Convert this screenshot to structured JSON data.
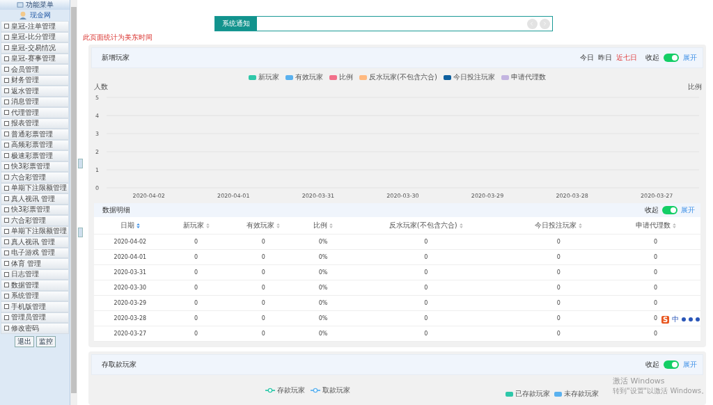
{
  "sidebar": {
    "title": "功能菜单",
    "user": "现金网",
    "items": [
      "皇冠-注单管理",
      "皇冠-比分管理",
      "皇冠-交易情况",
      "皇冠-赛事管理",
      "会员管理",
      "财务管理",
      "返水管理",
      "消息管理",
      "代理管理",
      "报表管理",
      "普通彩票管理",
      "高频彩票管理",
      "极速彩票管理",
      "快3彩票管理",
      "六合彩管理",
      "单期下注限额管理",
      "真人视讯 管理",
      "快3彩票管理",
      "六合彩管理",
      "单期下注限额管理",
      "真人视讯 管理",
      "电子游戏 管理",
      "体育 管理",
      "日志管理",
      "数据管理",
      "系统管理",
      "手机版管理",
      "管理员管理",
      "修改密码"
    ],
    "buttons": [
      "退出",
      "监控"
    ]
  },
  "notice": {
    "label": "系统通知"
  },
  "timezone_note": "此页面统计为美东时间",
  "new_players": {
    "title": "新增玩家",
    "ranges": [
      {
        "label": "今日",
        "selected": false
      },
      {
        "label": "昨日",
        "selected": false
      },
      {
        "label": "近七日",
        "selected": true
      }
    ],
    "collapse_label": "收起",
    "toggle_on": true,
    "expand_label": "展开",
    "chart_data": {
      "type": "line",
      "ylabel": "人数",
      "y2label": "比例",
      "grid": true,
      "legend": "top",
      "categories": [
        "2020-04-02",
        "2020-04-01",
        "2020-03-31",
        "2020-03-30",
        "2020-03-29",
        "2020-03-28",
        "2020-03-27"
      ],
      "ylim": [
        0,
        5
      ],
      "yticks": [
        0,
        1,
        2,
        3,
        4,
        5
      ],
      "series": [
        {
          "name": "新玩家",
          "color": "#2ec7a9",
          "values": [
            null,
            null,
            null,
            null,
            null,
            null,
            null
          ]
        },
        {
          "name": "有效玩家",
          "color": "#5ab1ef",
          "values": [
            null,
            null,
            null,
            null,
            null,
            null,
            null
          ]
        },
        {
          "name": "比例",
          "color": "#f2708a",
          "values": [
            null,
            null,
            null,
            null,
            null,
            null,
            null
          ]
        },
        {
          "name": "反水玩家(不包含六合)",
          "color": "#ffb980",
          "values": [
            null,
            null,
            null,
            null,
            null,
            null,
            null
          ]
        },
        {
          "name": "今日投注玩家",
          "color": "#0e5f9e",
          "values": [
            null,
            null,
            null,
            null,
            null,
            null,
            null
          ]
        },
        {
          "name": "申请代理数",
          "color": "#c3b4e0",
          "values": [
            null,
            null,
            null,
            null,
            null,
            null,
            null
          ]
        }
      ]
    },
    "details": {
      "title": "数据明细",
      "collapse_label": "收起",
      "toggle_on": true,
      "expand_label": "展开",
      "columns": [
        "日期",
        "新玩家",
        "有效玩家",
        "比例",
        "反水玩家(不包含六合)",
        "今日投注玩家",
        "申请代理数"
      ],
      "rows": [
        [
          "2020-04-02",
          "0",
          "0",
          "0%",
          "0",
          "0",
          "0"
        ],
        [
          "2020-04-01",
          "0",
          "0",
          "0%",
          "0",
          "0",
          "0"
        ],
        [
          "2020-03-31",
          "0",
          "0",
          "0%",
          "0",
          "0",
          "0"
        ],
        [
          "2020-03-30",
          "0",
          "0",
          "0%",
          "0",
          "0",
          "0"
        ],
        [
          "2020-03-29",
          "0",
          "0",
          "0%",
          "0",
          "0",
          "0"
        ],
        [
          "2020-03-28",
          "0",
          "0",
          "0%",
          "0",
          "0",
          "0"
        ],
        [
          "2020-03-27",
          "0",
          "0",
          "0%",
          "0",
          "0",
          "0"
        ]
      ]
    }
  },
  "deposit_players": {
    "title": "存取款玩家",
    "collapse_label": "收起",
    "toggle_on": true,
    "expand_label": "展开",
    "line_legend": [
      {
        "name": "存款玩家",
        "color": "#2ec7a9"
      },
      {
        "name": "取款玩家",
        "color": "#5ab1ef"
      }
    ],
    "bar_legend": [
      {
        "name": "已存款玩家",
        "color": "#2ec7a9"
      },
      {
        "name": "未存款玩家",
        "color": "#5ab1ef"
      }
    ]
  },
  "ime_toolbar": {
    "logo": "S",
    "mode": "中"
  },
  "activation": {
    "title": "激活 Windows",
    "hint": "转到\"设置\"以激活 Windows。"
  }
}
